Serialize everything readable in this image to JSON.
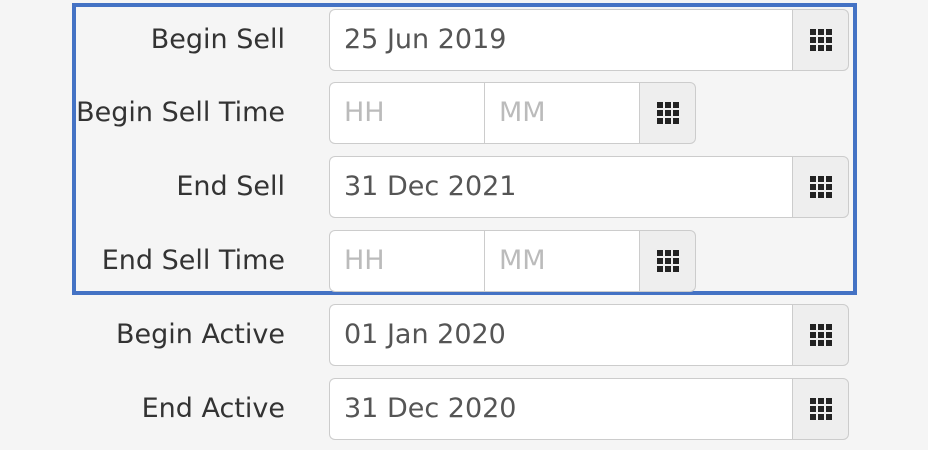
{
  "form": {
    "begin_sell": {
      "label": "Begin Sell",
      "value": "25 Jun 2019",
      "icon": "calendar-grid-icon"
    },
    "begin_sell_time": {
      "label": "Begin Sell Time",
      "hh_placeholder": "HH",
      "mm_placeholder": "MM",
      "icon": "time-grid-icon"
    },
    "end_sell": {
      "label": "End Sell",
      "value": "31 Dec 2021",
      "icon": "calendar-grid-icon"
    },
    "end_sell_time": {
      "label": "End Sell Time",
      "hh_placeholder": "HH",
      "mm_placeholder": "MM",
      "icon": "time-grid-icon"
    },
    "begin_active": {
      "label": "Begin Active",
      "value": "01 Jan 2020",
      "icon": "calendar-grid-icon"
    },
    "end_active": {
      "label": "End Active",
      "value": "31 Dec 2020",
      "icon": "calendar-grid-icon"
    }
  },
  "colors": {
    "highlight_border": "#4472c4",
    "background": "#f5f5f5",
    "addon_background": "#eeeeee"
  }
}
